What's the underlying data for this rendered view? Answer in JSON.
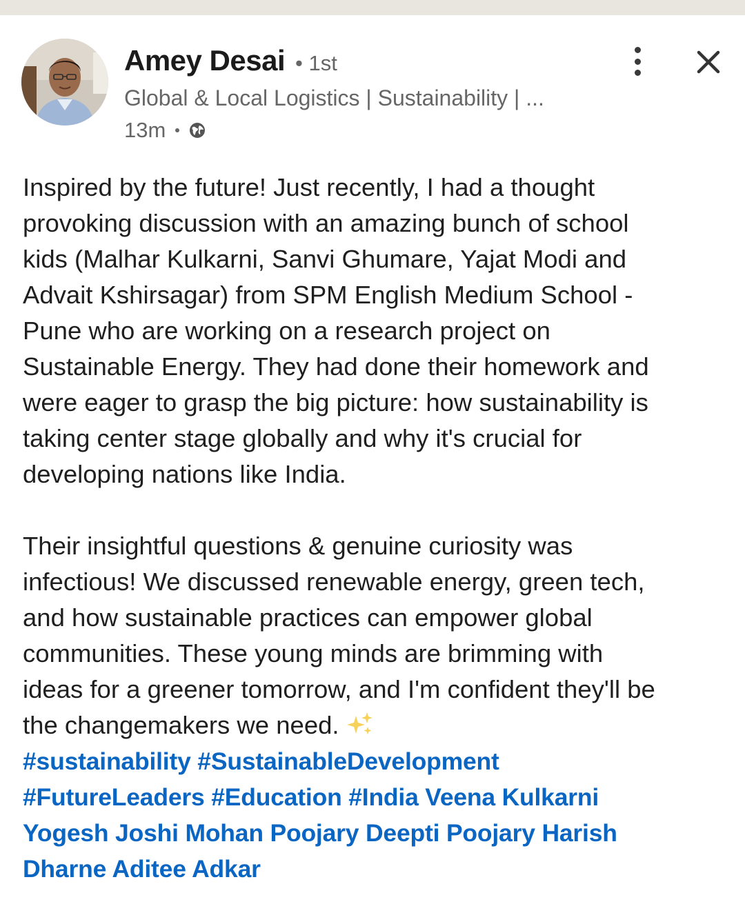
{
  "post": {
    "author_name": "Amey Desai",
    "connection_degree": "• 1st",
    "headline": "Global & Local Logistics | Sustainability | ...",
    "time_ago": "13m",
    "paragraph_1": "Inspired by the future!  Just recently, I had a thought\nprovoking discussion with an amazing bunch of school\nkids (Malhar Kulkarni, Sanvi Ghumare, Yajat Modi and\nAdvait Kshirsagar) from SPM English Medium School -\nPune who are working on a research project on\nSustainable Energy. They had done their homework and\nwere eager to grasp the big picture: how sustainability is\ntaking center stage globally and why it's crucial for\ndeveloping nations like India.",
    "paragraph_2": "Their insightful questions & genuine curiosity was\ninfectious! We discussed renewable energy, green tech,\nand how sustainable practices can empower global\ncommunities. These young minds are brimming with\nideas for a greener tomorrow, and I'm confident they'll be\nthe changemakers we need.",
    "emoji_icon": "sparkles-icon",
    "tag_lines": [
      [
        "#sustainability",
        "#SustainableDevelopment"
      ],
      [
        "#FutureLeaders",
        "#Education",
        "#India",
        "Veena Kulkarni"
      ],
      [
        "Yogesh Joshi",
        "Mohan Poojary",
        "Deepti Poojary",
        "Harish"
      ],
      [
        "Dharne",
        "Aditee Adkar"
      ]
    ]
  },
  "colors": {
    "link": "#0a66c2",
    "secondary_text": "#666666",
    "top_strip": "#e9e5df"
  }
}
